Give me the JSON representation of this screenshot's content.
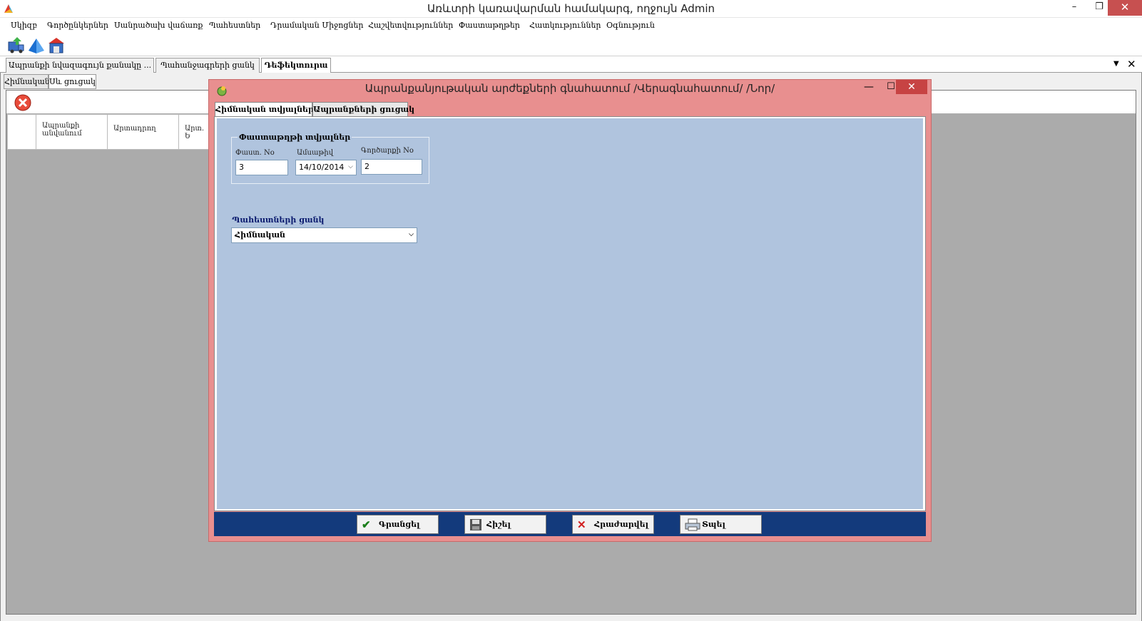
{
  "window": {
    "title": "Առևտրի կառավարման համակարգ, ողջույն Admin",
    "minimize": "–",
    "maximize": "❐",
    "close": "✕"
  },
  "menu": [
    "Սկիզբ",
    "Գործընկերներ",
    "Սանրածախ վաճառք",
    "Պահեստներ",
    "Դրամական Միջոցներ",
    "Հաշվետվություններ",
    "Փաստաթղթեր",
    "Հատկություններ",
    "Օգնություն"
  ],
  "doc_tabs": [
    "Ապրանքի նվազագույն քանակը ...",
    "Պահանջագրերի ցանկ",
    "Դեֆեկտուրա"
  ],
  "inner_tabs": [
    "Հիմնական",
    "Սև ցուցակ"
  ],
  "grid": {
    "columns": [
      "Ապրանքի անվանում",
      "Արտադրող",
      "Արտ. Ե"
    ]
  },
  "dialog": {
    "title": "Ապրանքանյութական արժեքների գնահատում /Վերագնահատում/ /Նոր/",
    "min": "—",
    "max": "☐",
    "close": "✕",
    "tabs": [
      "Հիմնական տվյալներ",
      "Ապրանքների ցուցակ"
    ],
    "doc_group_title": "Փաստաթղթի տվյալներ",
    "doc_number_label": "Փաստ. No",
    "doc_number": "3",
    "date_label": "Ամսաթիվ",
    "date": "14/10/2014",
    "operation_label": "Գործարքի No",
    "operation": "2",
    "warehouse_list_label": "Պահեստների ցանկ",
    "warehouse_selected": "Հիմնական",
    "buttons": {
      "save": "Գրանցել",
      "delete": "Հիշել",
      "cancel": "Հրաժարվել",
      "print": "Տպել"
    }
  },
  "colors": {
    "dialog_frame": "#e88f8f",
    "dialog_body": "#b0c4de",
    "footer": "#133a7c",
    "close_red": "#c75050"
  }
}
